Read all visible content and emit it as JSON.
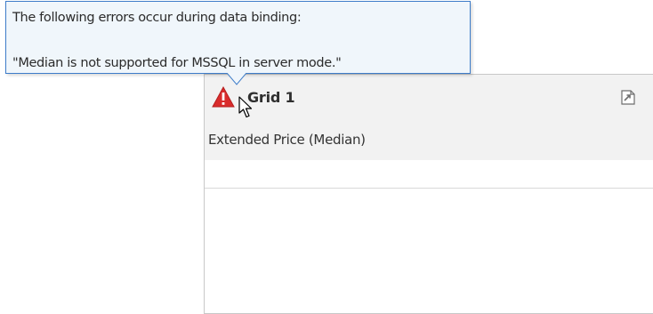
{
  "tooltip": {
    "line1": "The following errors occur during data binding:",
    "line2": "\"Median is not supported for MSSQL in server mode.\""
  },
  "grid": {
    "title": "Grid 1",
    "column_header": "Extended Price (Median)",
    "status_icon": "warning-icon",
    "export_icon": "export-icon"
  },
  "colors": {
    "warning": "#d92c2c",
    "tooltip_border": "#3d7cc9",
    "tooltip_background": "#f0f6fb",
    "header_background": "#f2f2f2"
  }
}
